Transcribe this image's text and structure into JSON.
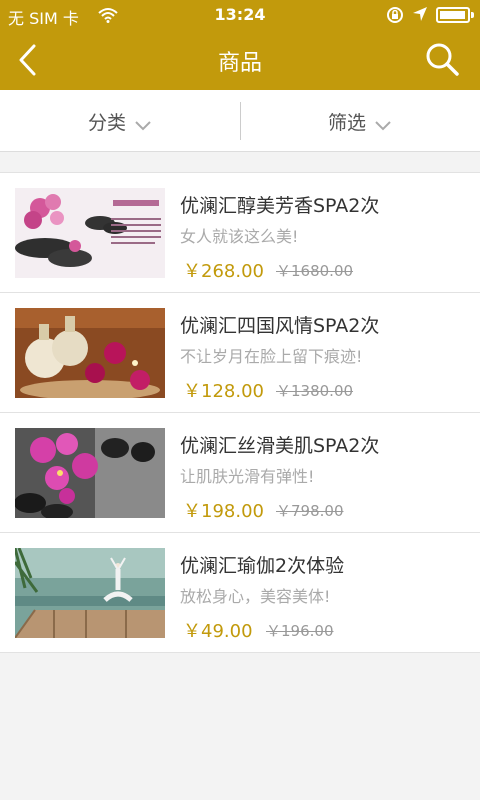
{
  "status_bar": {
    "carrier": "无 SIM 卡",
    "time": "13:24"
  },
  "nav": {
    "title": "商品"
  },
  "filters": {
    "category_label": "分类",
    "filter_label": "筛选"
  },
  "products": [
    {
      "name": "优澜汇醇美芳香SPA2次",
      "slogan": "女人就该这么美!",
      "price": "￥268.00",
      "original_price": "￥1680.00"
    },
    {
      "name": "优澜汇四国风情SPA2次",
      "slogan": "不让岁月在脸上留下痕迹!",
      "price": "￥128.00",
      "original_price": "￥1380.00"
    },
    {
      "name": "优澜汇丝滑美肌SPA2次",
      "slogan": "让肌肤光滑有弹性!",
      "price": "￥198.00",
      "original_price": "￥798.00"
    },
    {
      "name": "优澜汇瑜伽2次体验",
      "slogan": "放松身心，美容美体!",
      "price": "￥49.00",
      "original_price": "￥196.00"
    }
  ],
  "colors": {
    "brand_gold": "#c29a0c",
    "background": "#f3f3f3"
  }
}
